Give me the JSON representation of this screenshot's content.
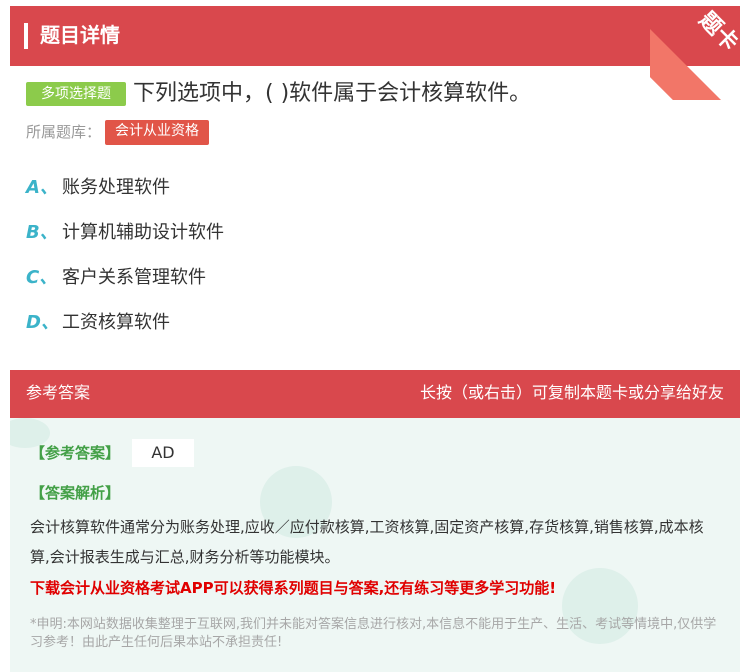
{
  "header": {
    "title": "题目详情",
    "badge": "题卡"
  },
  "question": {
    "type_tag": "多项选择题",
    "text": "下列选项中，( )软件属于会计核算软件。",
    "bank_label": "所属题库：",
    "bank_name": "会计从业资格"
  },
  "options": [
    {
      "letter": "A、",
      "text": "账务处理软件"
    },
    {
      "letter": "B、",
      "text": "计算机辅助设计软件"
    },
    {
      "letter": "C、",
      "text": "客户关系管理软件"
    },
    {
      "letter": "D、",
      "text": "工资核算软件"
    }
  ],
  "answer_section": {
    "title": "参考答案",
    "hint": "长按（或右击）可复制本题卡或分享给好友",
    "answer_label": "【参考答案】",
    "answer_value": "AD",
    "analysis_label": "【答案解析】",
    "analysis_text": "会计核算软件通常分为账务处理,应收／应付款核算,工资核算,固定资产核算,存货核算,销售核算,成本核算,会计报表生成与汇总,财务分析等功能模块。",
    "promo": "下载会计从业资格考试APP可以获得系列题目与答案,还有练习等更多学习功能!",
    "disclaimer": "*申明:本网站数据收集整理于互联网,我们并未能对答案信息进行核对,本信息不能用于生产、生活、考试等情境中,仅供学习参考！由此产生任何后果本站不承担责任!"
  },
  "colors": {
    "header_red": "#d9484d",
    "option_letter": "#3bb3c9",
    "tag_green": "#8ccb4b",
    "bank_tag_red": "#e15548",
    "answer_bg": "#eef7f4",
    "promo_red": "#e00000"
  }
}
